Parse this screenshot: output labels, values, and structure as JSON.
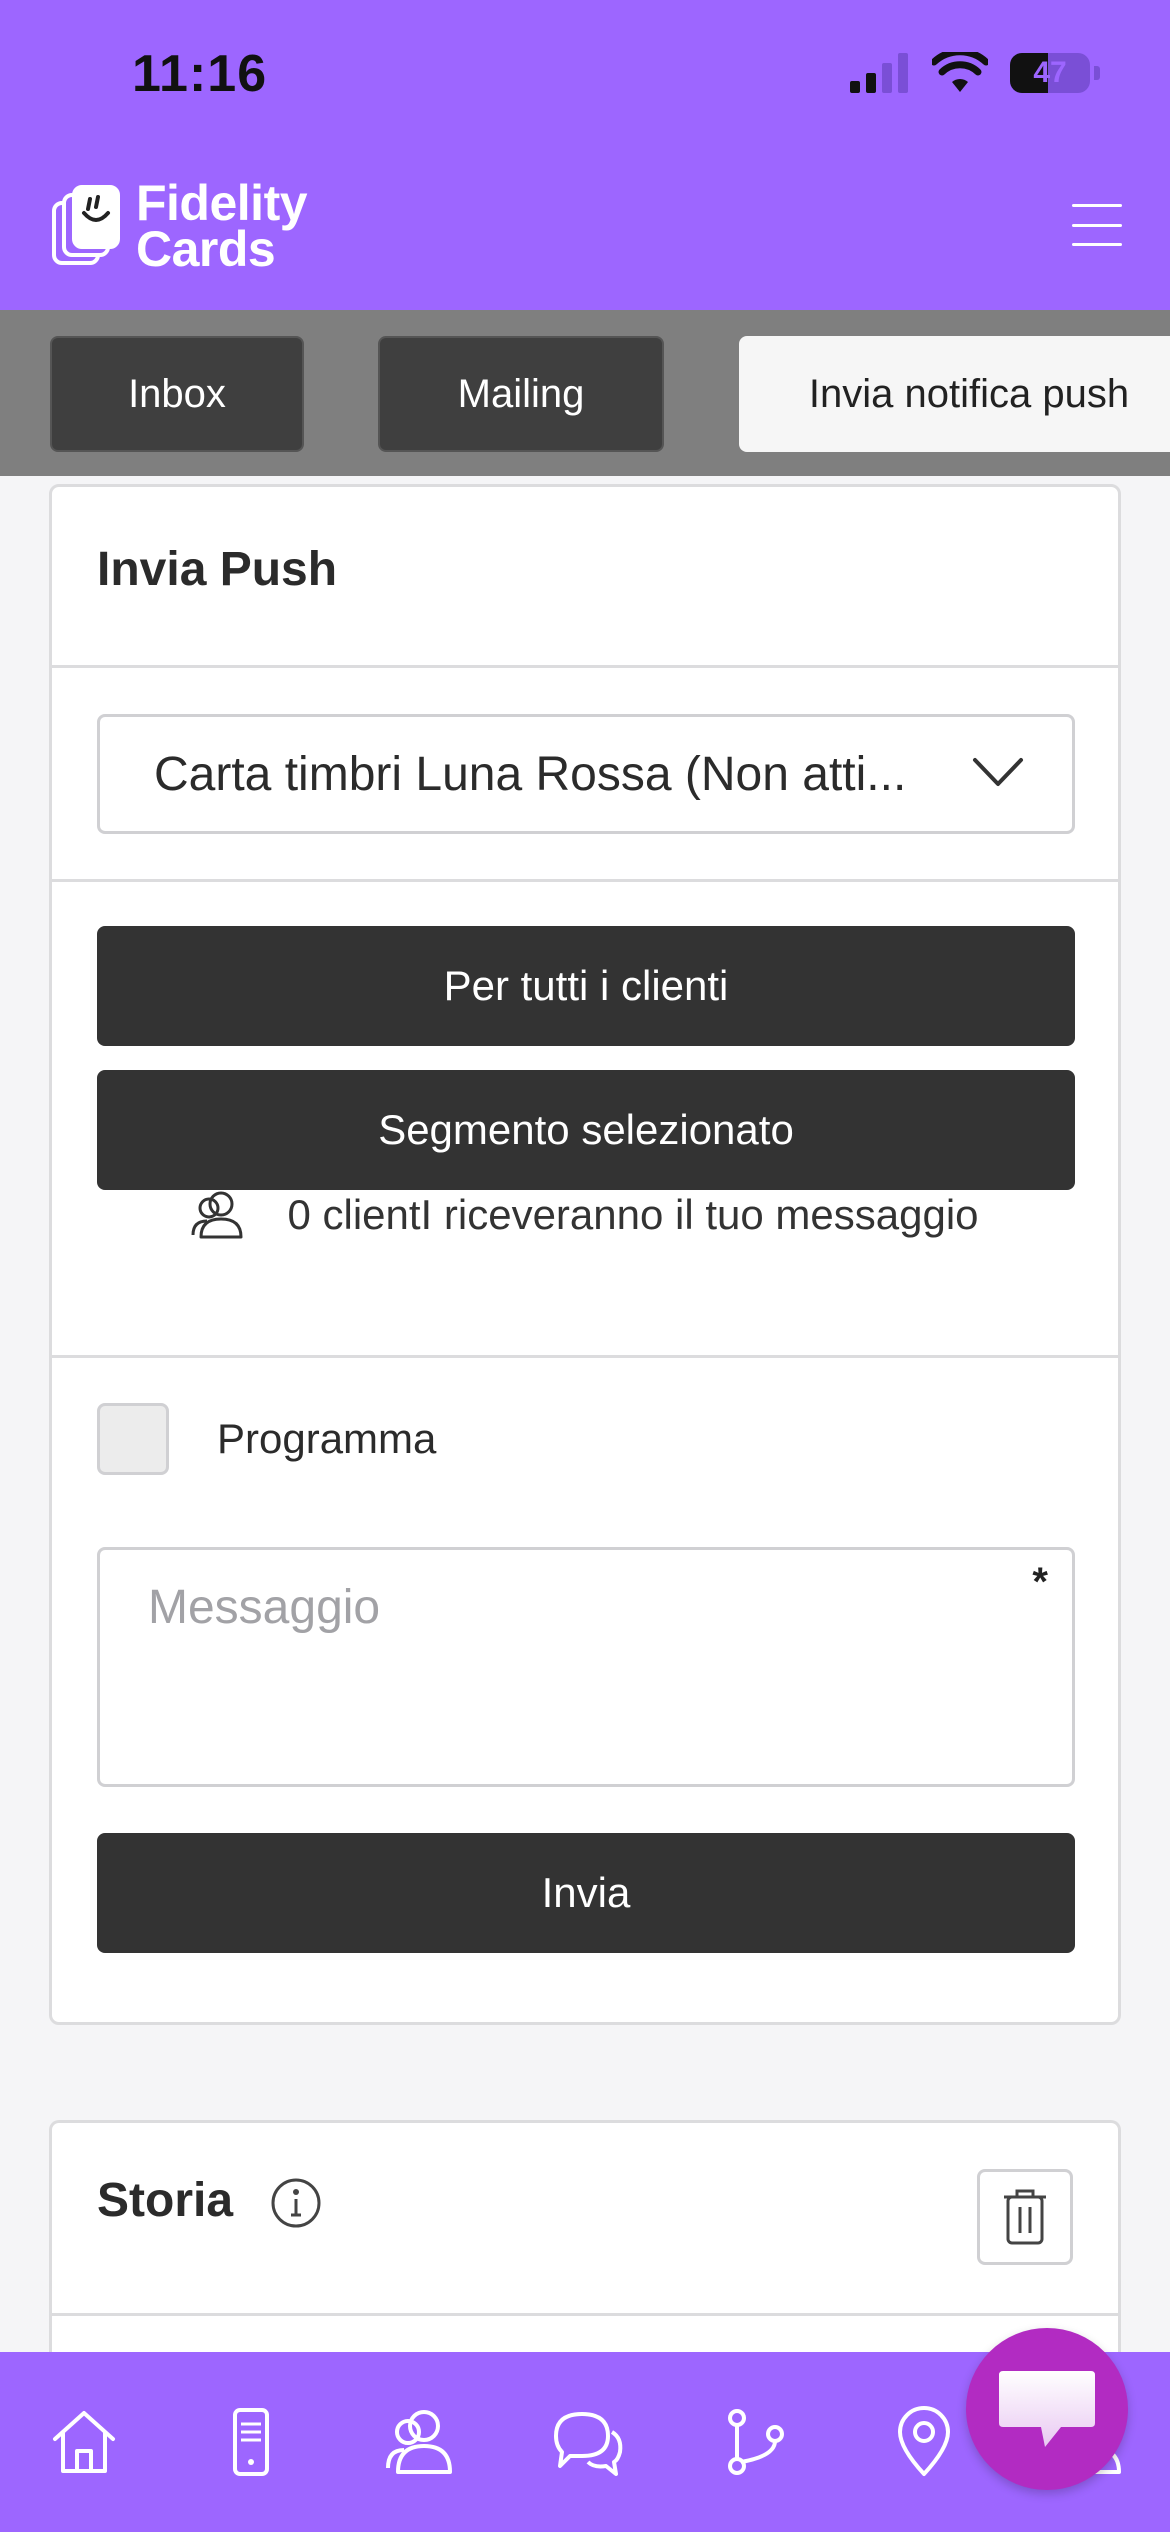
{
  "status_bar": {
    "time": "11:16",
    "battery_level": "47"
  },
  "header": {
    "logo_line1": "Fidelity",
    "logo_line2": "Cards",
    "accent_color": "#9d66ff"
  },
  "tabs": [
    {
      "label": "Inbox",
      "active": false
    },
    {
      "label": "Mailing",
      "active": false
    },
    {
      "label": "Invia notifica push",
      "active": true
    }
  ],
  "push_card": {
    "title": "Invia Push",
    "card_select": {
      "value": "Carta timbri Luna Rossa (Non atti..."
    },
    "btn_all": "Per tutti i clienti",
    "btn_segment": "Segmento selezionato",
    "recipients_text": "0 clientI riceveranno il tuo messaggio",
    "schedule_label": "Programma",
    "message_placeholder": "Messaggio",
    "required_mark": "*",
    "send_label": "Invia"
  },
  "history_card": {
    "title": "Storia"
  },
  "bottom_nav": {
    "items": [
      "home-icon",
      "device-icon",
      "users-icon",
      "chat-icon",
      "branch-icon",
      "location-icon",
      "profile-icon"
    ]
  },
  "colors": {
    "primary": "#9d66ff",
    "dark_button": "#333333",
    "fab": "#b22bc2",
    "tab_bar": "#7f7f7f"
  }
}
